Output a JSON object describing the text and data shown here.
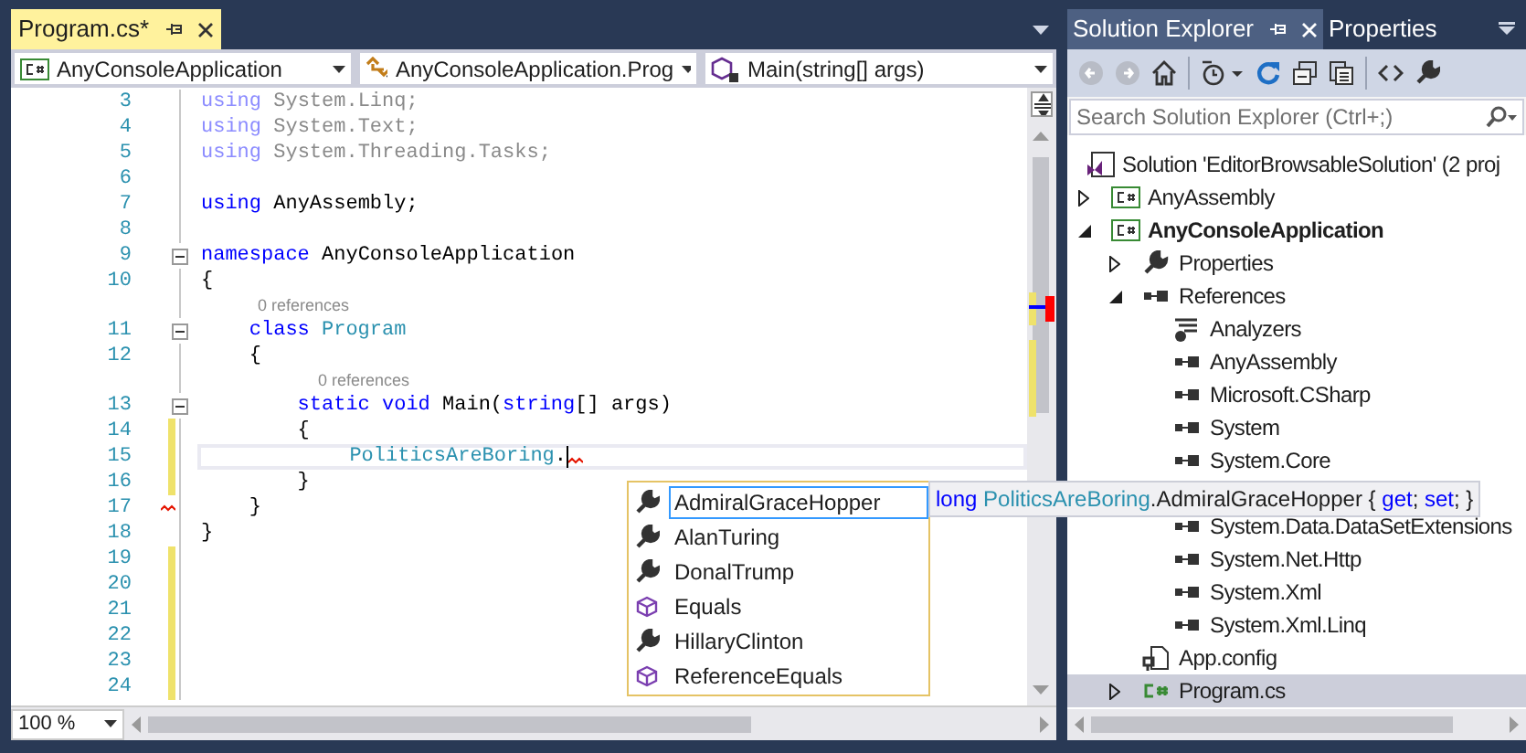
{
  "editor": {
    "tab": {
      "title": "Program.cs*",
      "selected": true
    },
    "nav": [
      {
        "kind": "project",
        "label": "AnyConsoleApplication"
      },
      {
        "kind": "class",
        "label": "AnyConsoleApplication.Prog"
      },
      {
        "kind": "method",
        "label": "Main(string[] args)"
      }
    ],
    "lines": [
      {
        "kind": "code",
        "num": "3",
        "changed": false,
        "faded": true,
        "fold": false,
        "tokens": [
          {
            "kind": "kw",
            "s": "using"
          },
          {
            "kind": "plain",
            "s": " System.Linq;"
          }
        ]
      },
      {
        "kind": "code",
        "num": "4",
        "changed": false,
        "faded": true,
        "fold": false,
        "tokens": [
          {
            "kind": "kw",
            "s": "using"
          },
          {
            "kind": "plain",
            "s": " System.Text;"
          }
        ]
      },
      {
        "kind": "code",
        "num": "5",
        "changed": false,
        "faded": true,
        "fold": false,
        "tokens": [
          {
            "kind": "kw",
            "s": "using"
          },
          {
            "kind": "plain",
            "s": " System.Threading.Tasks;"
          }
        ]
      },
      {
        "kind": "code",
        "num": "6",
        "changed": false,
        "fold": false
      },
      {
        "kind": "code",
        "num": "7",
        "changed": false,
        "faded": false,
        "fold": false,
        "tokens": [
          {
            "kind": "kw",
            "s": "using"
          },
          {
            "kind": "plain",
            "s": " AnyAssembly;"
          }
        ]
      },
      {
        "kind": "code",
        "num": "8",
        "changed": false,
        "fold": false
      },
      {
        "kind": "code",
        "num": "9",
        "changed": false,
        "faded": false,
        "fold": true,
        "tokens": [
          {
            "kind": "kw",
            "s": "namespace"
          },
          {
            "kind": "plain",
            "s": " AnyConsoleApplication"
          }
        ]
      },
      {
        "kind": "code",
        "num": "10",
        "changed": false,
        "faded": false,
        "fold": false,
        "tokens": [
          {
            "kind": "plain",
            "s": "{"
          }
        ],
        "children": [
          {
            "kind": "lens",
            "text": "0 references"
          },
          {
            "kind": "code",
            "num": "11",
            "changed": false,
            "faded": false,
            "fold": true,
            "tokens": [
              {
                "kind": "kw",
                "s": "class"
              },
              {
                "kind": "type",
                "s": " Program"
              }
            ]
          },
          {
            "kind": "code",
            "num": "12",
            "changed": false,
            "faded": false,
            "fold": false,
            "tokens": [
              {
                "kind": "plain",
                "s": "{"
              }
            ],
            "children": [
              {
                "kind": "lens",
                "text": "0 references"
              },
              {
                "kind": "code",
                "num": "13",
                "changed": false,
                "faded": false,
                "fold": true,
                "tokens": [
                  {
                    "kind": "kw",
                    "s": "static void"
                  },
                  {
                    "kind": "plain",
                    "s": " Main("
                  },
                  {
                    "kind": "kw",
                    "s": "string"
                  },
                  {
                    "kind": "plain",
                    "s": "[] args)"
                  }
                ]
              },
              {
                "kind": "code",
                "num": "14",
                "changed": true,
                "faded": false,
                "fold": false,
                "tokens": [
                  {
                    "kind": "plain",
                    "s": "{"
                  }
                ],
                "children": [
                  {
                    "kind": "code",
                    "num": "15",
                    "changed": true,
                    "faded": false,
                    "fold": false,
                    "current": true,
                    "error_squiggle": true,
                    "tokens": [
                      {
                        "kind": "type",
                        "s": "PoliticsAreBoring"
                      },
                      {
                        "kind": "plain",
                        "s": "."
                      }
                    ]
                  }
                ]
              },
              {
                "kind": "code",
                "num": "16",
                "changed": true,
                "faded": false,
                "fold": false,
                "tokens": [
                  {
                    "kind": "plain",
                    "s": "}"
                  }
                ]
              }
            ]
          },
          {
            "kind": "code",
            "num": "17",
            "changed": false,
            "faded": false,
            "fold": false,
            "margin_squiggle": true,
            "tokens": [
              {
                "kind": "plain",
                "s": "}"
              }
            ]
          }
        ]
      },
      {
        "kind": "code",
        "num": "18",
        "changed": false,
        "faded": false,
        "fold": false,
        "tokens": [
          {
            "kind": "plain",
            "s": "}"
          }
        ]
      },
      {
        "kind": "code",
        "num": "19",
        "changed": true,
        "fold": false
      },
      {
        "kind": "code",
        "num": "20",
        "changed": true,
        "fold": false
      },
      {
        "kind": "code",
        "num": "21",
        "changed": true,
        "fold": false
      },
      {
        "kind": "code",
        "num": "22",
        "changed": true,
        "fold": false
      },
      {
        "kind": "code",
        "num": "23",
        "changed": true,
        "fold": false
      },
      {
        "kind": "code",
        "num": "24",
        "changed": true,
        "fold": false
      }
    ],
    "zoom": "100 %",
    "completion": [
      {
        "kind": "property",
        "label": "AdmiralGraceHopper",
        "selected": true
      },
      {
        "kind": "property",
        "label": "AlanTuring",
        "selected": false
      },
      {
        "kind": "property",
        "label": "DonalTrump",
        "selected": false
      },
      {
        "kind": "method",
        "label": "Equals",
        "selected": false
      },
      {
        "kind": "property",
        "label": "HillaryClinton",
        "selected": false
      },
      {
        "kind": "method",
        "label": "ReferenceEquals",
        "selected": false
      }
    ],
    "tooltip": [
      {
        "kind": "kw",
        "s": "long"
      },
      {
        "kind": "type",
        "s": " PoliticsAreBoring"
      },
      {
        "kind": "plain",
        "s": ".AdmiralGraceHopper { "
      },
      {
        "kind": "kw",
        "s": "get"
      },
      {
        "kind": "plain",
        "s": "; "
      },
      {
        "kind": "kw",
        "s": "set"
      },
      {
        "kind": "plain",
        "s": "; }"
      }
    ]
  },
  "solution_explorer": {
    "tabs": [
      {
        "label": "Solution Explorer",
        "selected": true
      },
      {
        "label": "Properties",
        "selected": false
      }
    ],
    "search": {
      "placeholder": "Search Solution Explorer (Ctrl+;)"
    },
    "tree": [
      {
        "kind": "solution",
        "label": "Solution 'EditorBrowsableSolution' (2 proj",
        "selected": false,
        "bold": false,
        "children": [
          {
            "kind": "project",
            "label": "AnyAssembly",
            "expanded": false,
            "selected": false,
            "bold": false
          },
          {
            "kind": "project",
            "label": "AnyConsoleApplication",
            "expanded": true,
            "selected": false,
            "bold": true,
            "children": [
              {
                "kind": "properties",
                "label": "Properties",
                "expanded": false,
                "selected": false,
                "bold": false
              },
              {
                "kind": "references",
                "label": "References",
                "expanded": true,
                "selected": false,
                "bold": false,
                "children": [
                  {
                    "kind": "analyzers",
                    "label": "Analyzers",
                    "selected": false,
                    "bold": false
                  },
                  {
                    "kind": "reference",
                    "label": "AnyAssembly",
                    "selected": false,
                    "bold": false
                  },
                  {
                    "kind": "reference",
                    "label": "Microsoft.CSharp",
                    "selected": false,
                    "bold": false
                  },
                  {
                    "kind": "reference",
                    "label": "System",
                    "selected": false,
                    "bold": false
                  },
                  {
                    "kind": "reference",
                    "label": "System.Core",
                    "selected": false,
                    "bold": false
                  },
                  {
                    "kind": "gap"
                  },
                  {
                    "kind": "reference",
                    "label": "System.Data.DataSetExtensions",
                    "selected": false,
                    "bold": false
                  },
                  {
                    "kind": "reference",
                    "label": "System.Net.Http",
                    "selected": false,
                    "bold": false
                  },
                  {
                    "kind": "reference",
                    "label": "System.Xml",
                    "selected": false,
                    "bold": false
                  },
                  {
                    "kind": "reference",
                    "label": "System.Xml.Linq",
                    "selected": false,
                    "bold": false
                  }
                ]
              },
              {
                "kind": "config",
                "label": "App.config",
                "selected": false,
                "bold": false
              },
              {
                "kind": "csfile",
                "label": "Program.cs",
                "expanded": false,
                "selected": true,
                "bold": false
              }
            ]
          }
        ]
      }
    ]
  }
}
